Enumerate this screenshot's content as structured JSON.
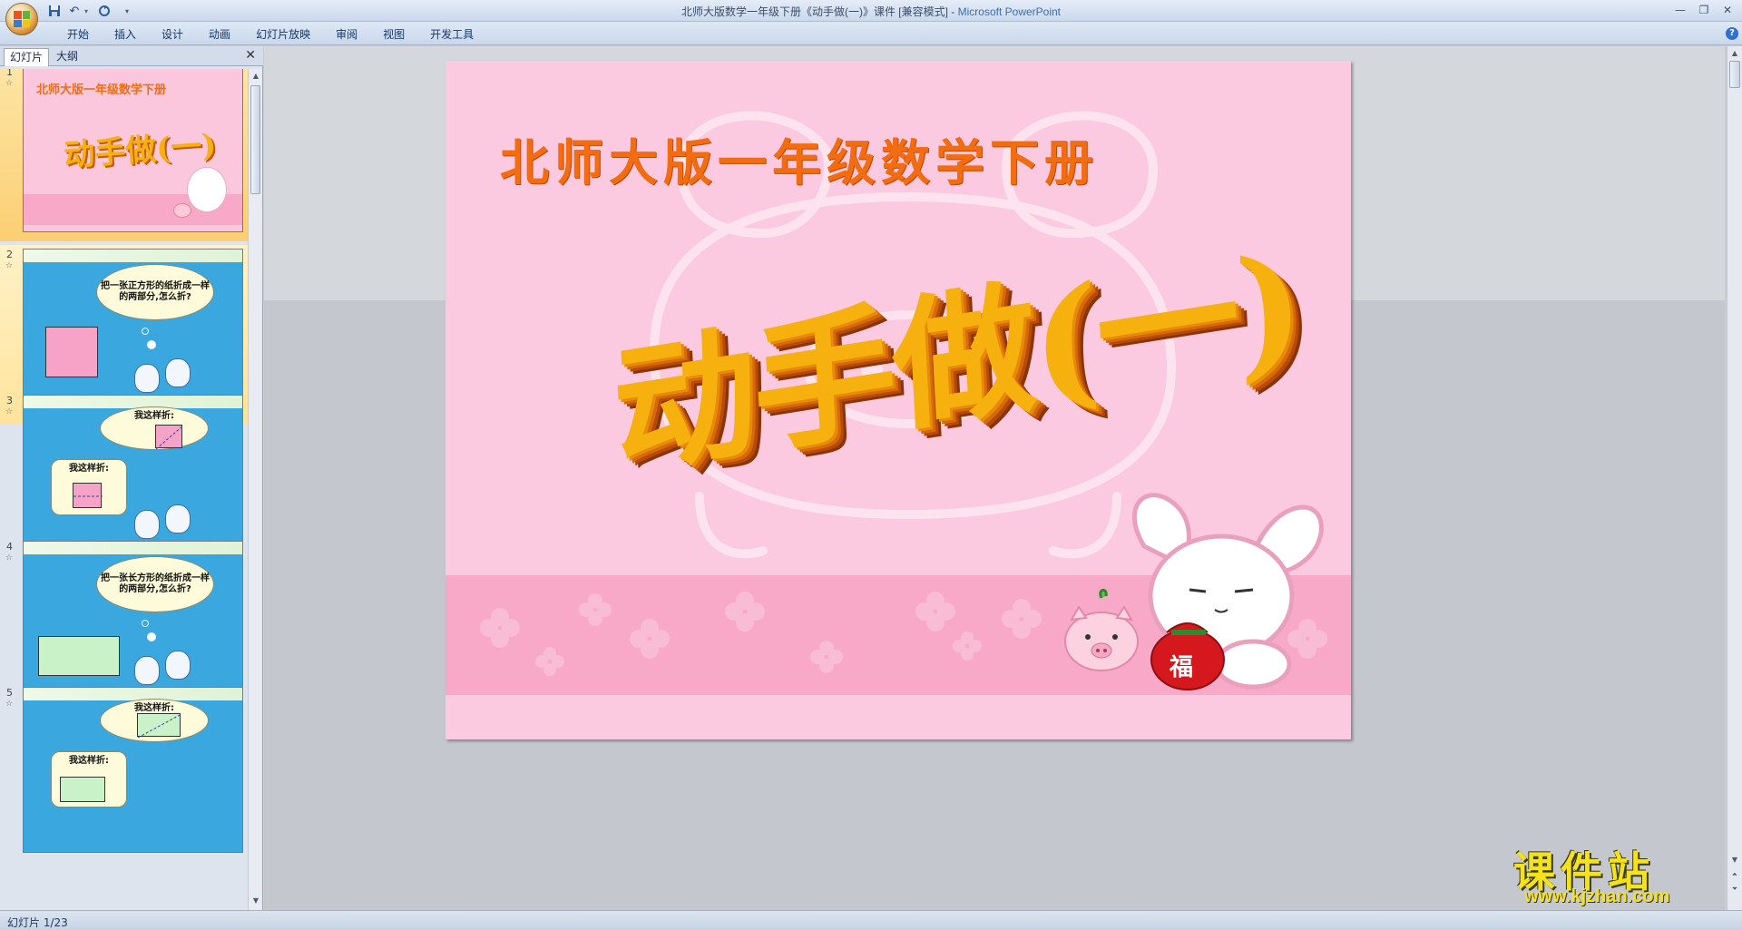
{
  "window": {
    "title_doc": "北师大版数学一年级下册《动手做(一)》课件 [兼容模式] - ",
    "title_app": "Microsoft PowerPoint"
  },
  "ribbon": {
    "tabs": [
      "开始",
      "插入",
      "设计",
      "动画",
      "幻灯片放映",
      "审阅",
      "视图",
      "开发工具"
    ]
  },
  "left_pane": {
    "tabs": {
      "slides": "幻灯片",
      "outline": "大纲"
    },
    "close": "✕",
    "thumbnails": [
      {
        "num": "1",
        "headline": "北师大版一年级数学下册",
        "big": "动手做(一)"
      },
      {
        "num": "2",
        "bubble": "把一张正方形的纸折成一样的两部分,怎么折?"
      },
      {
        "num": "3",
        "bubble_top": "我这样折:",
        "bubble_left": "我这样折:"
      },
      {
        "num": "4",
        "bubble": "把一张长方形的纸折成一样的两部分,怎么折?"
      },
      {
        "num": "5",
        "bubble_top": "我这样折:",
        "bubble_left": "我这样折:"
      }
    ]
  },
  "slide": {
    "headline": "北师大版一年级数学下册",
    "big_title": "动手做(一)",
    "bag_char": "福"
  },
  "status": {
    "slide_indicator": "幻灯片 1/23"
  },
  "watermark": {
    "name": "课件站",
    "url": "www.kjzhan.com"
  },
  "colors": {
    "slide_bg": "#fbc9e0",
    "headline": "#f36c10",
    "big_title": "#f7b10f",
    "thumb_blue": "#3aa8de",
    "watermark_yellow": "#f5e21a"
  }
}
